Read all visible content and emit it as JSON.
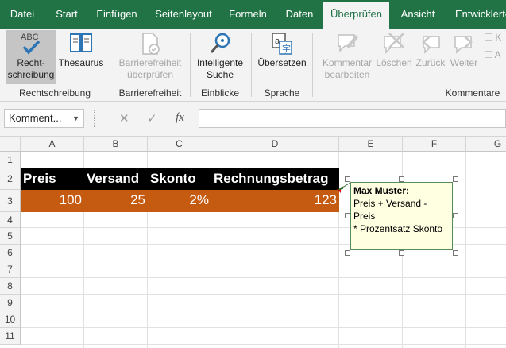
{
  "tabs": [
    "Datei",
    "Start",
    "Einfügen",
    "Seitenlayout",
    "Formeln",
    "Daten",
    "Überprüfen",
    "Ansicht",
    "Entwicklertools"
  ],
  "active_tab": "Überprüfen",
  "ribbon": {
    "spelling_line1": "Recht-",
    "spelling_line2": "schreibung",
    "spelling_icon_text": "ABC",
    "thesaurus": "Thesaurus",
    "accessibility_line1": "Barrierefreiheit",
    "accessibility_line2": "überprüfen",
    "smart_line1": "Intelligente",
    "smart_line2": "Suche",
    "translate": "Übersetzen",
    "new_comment_line1": "Kommentar",
    "new_comment_line2": "bearbeiten",
    "delete": "Löschen",
    "back": "Zurück",
    "next": "Weiter",
    "cut_k": "K",
    "cut_a": "A",
    "groups": [
      "Rechtschreibung",
      "Barrierefreiheit",
      "Einblicke",
      "Sprache",
      "Kommentare"
    ]
  },
  "formula_bar": {
    "name_box": "Komment...",
    "cancel": "✕",
    "enter": "✓",
    "fx": "fx",
    "value": ""
  },
  "columns": [
    "A",
    "B",
    "C",
    "D",
    "E",
    "F",
    "G"
  ],
  "rows": [
    "1",
    "2",
    "3",
    "4",
    "5",
    "6",
    "7",
    "8",
    "9",
    "10",
    "11"
  ],
  "cells": {
    "A2": "Preis",
    "B2": "Versand",
    "C2": "Skonto",
    "D2": "Rechnungsbetrag",
    "A3": "100",
    "B3": "25",
    "C3": "2%",
    "D3": "123"
  },
  "comment": {
    "author": "Max Muster:",
    "line1": "Preis + Versand - Preis",
    "line2": "* Prozentsatz Skonto"
  },
  "colors": {
    "ribbon_green": "#217346",
    "header_fill": "#000000",
    "value_fill": "#c55a11",
    "comment_fill": "#ffffe1"
  }
}
